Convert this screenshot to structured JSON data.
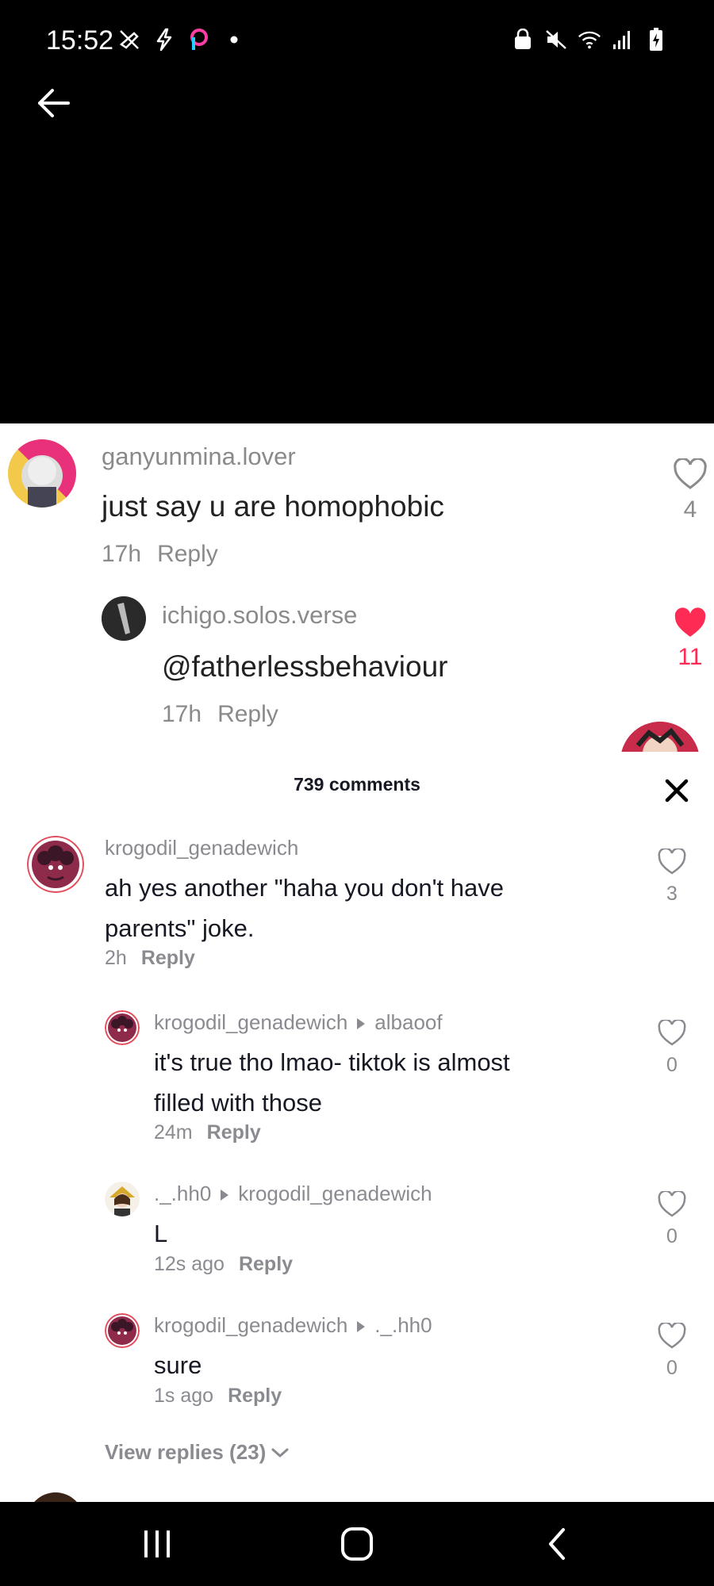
{
  "status_bar": {
    "time": "15:52",
    "left_icons": [
      "no-fly-icon",
      "flash-icon",
      "picsart-icon",
      "dot-icon"
    ],
    "right_icons": [
      "lock-icon",
      "mute-icon",
      "wifi-icon",
      "signal-icon",
      "battery-charging-icon"
    ]
  },
  "background_comments": [
    {
      "user": "ganyunmina.lover",
      "text": "just say u are homophobic",
      "time": "17h",
      "reply": "Reply",
      "likes": "4",
      "liked": false
    },
    {
      "user": "ichigo.solos.verse",
      "text": "@fatherlessbehaviour",
      "time": "17h",
      "reply": "Reply",
      "likes": "11",
      "liked": true
    }
  ],
  "sheet": {
    "title": "739 comments",
    "close_icon": "close-icon"
  },
  "comments": [
    {
      "user": "krogodil_genadewich",
      "reply_to": "",
      "text_lines": [
        "ah yes another \"haha you don't have",
        "parents\" joke."
      ],
      "time": "2h",
      "reply": "Reply",
      "likes": "3"
    },
    {
      "user": "krogodil_genadewich",
      "reply_to": "albaoof",
      "text_lines": [
        "it's true tho lmao- tiktok is almost",
        "filled with those"
      ],
      "time": "24m",
      "reply": "Reply",
      "likes": "0"
    },
    {
      "user": "._.hh0",
      "reply_to": "krogodil_genadewich",
      "text_lines": [
        "L"
      ],
      "time": "12s ago",
      "reply": "Reply",
      "likes": "0"
    },
    {
      "user": "krogodil_genadewich",
      "reply_to": "._.hh0",
      "text_lines": [
        "sure"
      ],
      "time": "1s ago",
      "reply": "Reply",
      "likes": "0"
    }
  ],
  "view_replies": "View replies (23)",
  "nav_bar": {
    "icons": [
      "recent-apps-icon",
      "home-icon",
      "back-icon"
    ]
  },
  "colors": {
    "liked_heart": "#fe2c55",
    "muted_text": "#8a8b91",
    "primary_text": "#161823"
  }
}
